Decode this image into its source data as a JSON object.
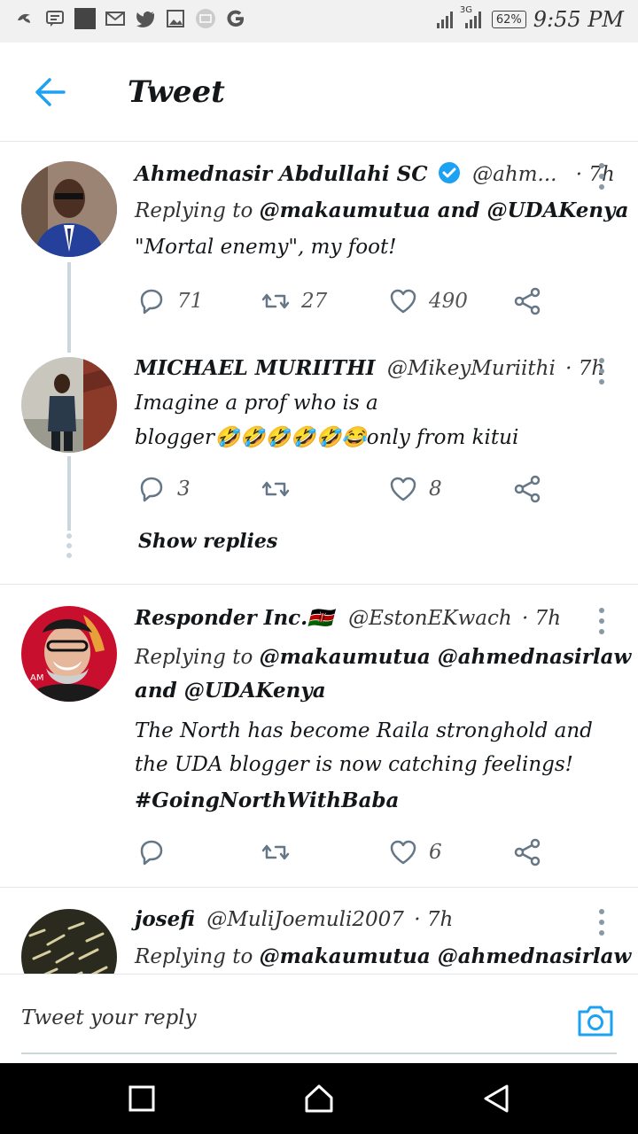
{
  "status_bar": {
    "time": "9:55 PM",
    "battery": "62%",
    "network": "3G",
    "left_icons": [
      "bird-icon",
      "message-icon",
      "square-icon",
      "gmail-icon",
      "twitter-icon",
      "image-icon",
      "mail-circle-icon",
      "google-icon"
    ]
  },
  "header": {
    "title": "Tweet",
    "back_icon": "arrow-left-icon"
  },
  "tweets": [
    {
      "name": "Ahmednasir Abdullahi SC",
      "verified": true,
      "handle": "@ahm...",
      "time": "· 7h",
      "replying_prefix": "Replying to",
      "replying_mentions": "@makaumutua and @UDAKenya",
      "text": "\"Mortal enemy\", my foot!",
      "counts": {
        "replies": "71",
        "retweets": "27",
        "likes": "490"
      }
    },
    {
      "name": "MICHAEL MURIITHI",
      "handle": "@MikeyMuriithi",
      "time": "· 7h",
      "text_line1": "Imagine a prof who is a",
      "text_line2": "blogger🤣🤣🤣🤣🤣😂only from kitui",
      "counts": {
        "replies": "3",
        "retweets": "",
        "likes": "8"
      },
      "show_replies": "Show replies"
    },
    {
      "name": "Responder Inc.🇰🇪",
      "handle": "@EstonEKwach",
      "time": "· 7h",
      "replying_prefix": "Replying to",
      "replying_mentions_line1": "@makaumutua @ahmednasirlaw",
      "replying_mentions_line2": "and @UDAKenya",
      "text_line1": "The North has become Raila stronghold and",
      "text_line2": "the UDA blogger is now catching feelings!",
      "hashtag": "#GoingNorthWithBaba",
      "counts": {
        "replies": "",
        "retweets": "",
        "likes": "6"
      }
    },
    {
      "name": "josefi",
      "handle": "@MuliJoemuli2007",
      "time": "· 7h",
      "replying_prefix": "Replying to",
      "replying_mentions": "@makaumutua @ahmednasirlaw"
    }
  ],
  "reply_bar": {
    "placeholder": "Tweet your reply",
    "camera_icon": "camera-icon"
  },
  "nav_bar": {
    "buttons": [
      "recents-square-icon",
      "home-icon",
      "back-triangle-icon"
    ]
  },
  "colors": {
    "accent": "#1da1f2",
    "verified": "#1da1f2",
    "icon_gray": "#657786",
    "divider": "#e1e8ed"
  }
}
